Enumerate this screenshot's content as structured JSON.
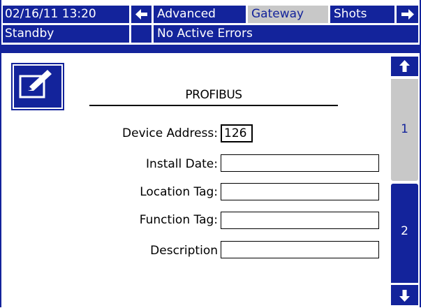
{
  "header": {
    "datetime": "02/16/11 13:20",
    "tabs": [
      {
        "label": "Advanced",
        "active": false
      },
      {
        "label": "Gateway",
        "active": true
      },
      {
        "label": "Shots",
        "active": false
      }
    ]
  },
  "status": {
    "mode": "Standby",
    "errors": "No Active Errors"
  },
  "panel": {
    "title": "PROFIBUS",
    "fields": [
      {
        "label": "Device Address:",
        "value": "126"
      },
      {
        "label": "Install Date:",
        "value": ""
      },
      {
        "label": "Location Tag:",
        "value": ""
      },
      {
        "label": "Function Tag:",
        "value": ""
      },
      {
        "label": "Description",
        "value": ""
      }
    ]
  },
  "pager": {
    "page1": "1",
    "page2": "2",
    "current": 1
  },
  "colors": {
    "primary": "#13239b",
    "active_tab": "#c8c8c8",
    "background": "#ffffff"
  },
  "icons": {
    "prev": "arrow-left-icon",
    "next": "arrow-right-icon",
    "up": "arrow-up-icon",
    "down": "arrow-down-icon",
    "edit": "edit-icon"
  }
}
